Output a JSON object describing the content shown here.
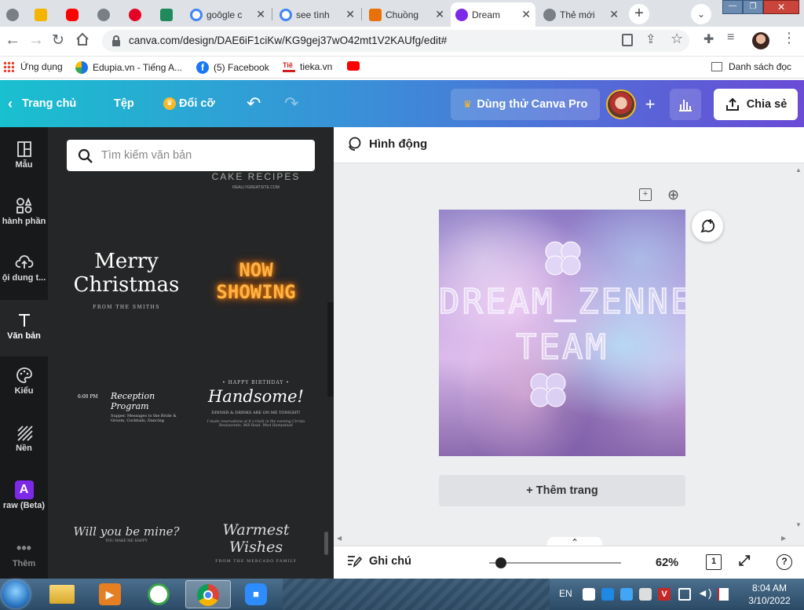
{
  "browser": {
    "tabs": [
      {
        "label": "",
        "color": "#5f6368"
      },
      {
        "label": "",
        "color": "#f4b400"
      },
      {
        "label": "",
        "color": "#ff0000"
      },
      {
        "label": "",
        "color": "#5f6368"
      },
      {
        "label": "",
        "color": "#e60023"
      },
      {
        "label": "",
        "color": "#1f8a5c"
      },
      {
        "label": "goôgle c",
        "color": "#4285f4"
      },
      {
        "label": "see tình",
        "color": "#4285f4"
      },
      {
        "label": "Chuồng",
        "color": "#e8710a"
      },
      {
        "label": "Dream",
        "color": "#7d2ae8"
      },
      {
        "label": "Thẻ mới",
        "color": "#5f6368"
      }
    ],
    "url": "canva.com/design/DAE6iF1ciKw/KG9gej37wO42mt1V2KAUfg/edit#",
    "bookmarks": [
      "Ứng dụng",
      "Edupia.vn - Tiếng A...",
      "(5) Facebook",
      "tieka.vn",
      ""
    ],
    "reading_list": "Danh sách đọc"
  },
  "canva": {
    "home": "Trang chủ",
    "file": "Tệp",
    "resize": "Đổi cỡ",
    "pro": "Dùng thử Canva Pro",
    "share": "Chia sẻ",
    "rail": [
      {
        "label": "Mẫu",
        "icon": "template-icon"
      },
      {
        "label": "hành phần",
        "icon": "elements-icon"
      },
      {
        "label": "ội dung t...",
        "icon": "upload-icon"
      },
      {
        "label": "Văn bản",
        "icon": "text-icon"
      },
      {
        "label": "Kiểu",
        "icon": "palette-icon"
      },
      {
        "label": "Nền",
        "icon": "background-icon"
      },
      {
        "label": "raw (Beta)",
        "icon": "draw-icon"
      },
      {
        "label": "Thêm",
        "icon": "more-icon"
      }
    ],
    "search_placeholder": "Tìm kiếm văn bản",
    "templates": {
      "t1_top": "CAKE RECIPES",
      "t1_sub": "REALLYGREATSITE.COM",
      "t2_line1": "Merry",
      "t2_line2": "Christmas",
      "t2_sub": "FROM THE SMITHS",
      "t3_line1": "NOW",
      "t3_line2": "SHOWING",
      "t4_time": "6:00 PM",
      "t4_title1": "Reception",
      "t4_title2": "Program",
      "t4_body": "Supper, Messages to the Bride & Groom, Cocktails, Dancing",
      "t5_top": "• HAPPY BIRTHDAY •",
      "t5_title": "Handsome!",
      "t5_sub": "DINNER & DRINKS ARE ON ME TONIGHT!",
      "t5_body": "I made reservations at 8 o'clock in the evening Cirrala Restaurants, Mill Road, West Hampstead",
      "t6_title": "Will you be mine?",
      "t6_sub": "YOU MAKE ME HAPPY",
      "t7_title": "Warmest Wishes",
      "t7_sub": "FROM THE MERCADO FAMILY"
    },
    "animate": "Hình động",
    "design_line1": "DREAM_ZENNE_",
    "design_line2": "TEAM",
    "add_page": "+ Thêm trang",
    "notes": "Ghi chú",
    "zoom": "62%",
    "zoom_level": 0.1,
    "page_count": "1",
    "help": "?"
  },
  "taskbar": {
    "lang": "EN",
    "time": "8:04 AM",
    "date": "3/10/2022"
  }
}
